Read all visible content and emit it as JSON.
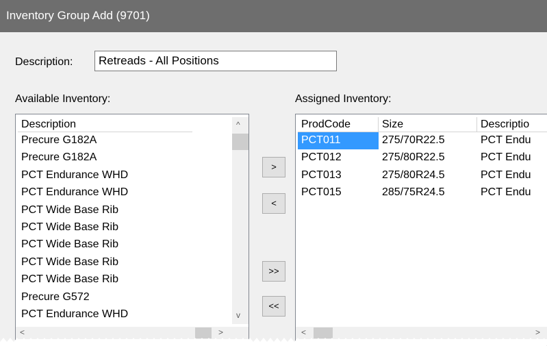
{
  "window": {
    "title": "Inventory Group Add (9701)"
  },
  "description": {
    "label": "Description:",
    "value": "Retreads - All Positions"
  },
  "available": {
    "label": "Available Inventory:",
    "header": "Description",
    "rows": [
      "Precure G182A",
      "Precure G182A",
      "PCT Endurance WHD",
      "PCT Endurance WHD",
      "PCT Wide Base Rib",
      "PCT Wide Base Rib",
      "PCT Wide Base Rib",
      "PCT Wide Base Rib",
      "PCT Wide Base Rib",
      "Precure G572",
      "PCT Endurance WHD"
    ]
  },
  "buttons": {
    "add": ">",
    "remove": "<",
    "add_all": ">>",
    "remove_all": "<<"
  },
  "assigned": {
    "label": "Assigned Inventory:",
    "headers": [
      "ProdCode",
      "Size",
      "Descriptio"
    ],
    "rows": [
      {
        "code": "PCT011",
        "size": "275/70R22.5",
        "desc": "PCT Endu"
      },
      {
        "code": "PCT012",
        "size": "275/80R22.5",
        "desc": "PCT Endu"
      },
      {
        "code": "PCT013",
        "size": "275/80R24.5",
        "desc": "PCT Endu"
      },
      {
        "code": "PCT015",
        "size": "285/75R24.5",
        "desc": "PCT Endu"
      }
    ]
  },
  "icons": {
    "scroll_up": "^",
    "scroll_down": "v",
    "scroll_left": "<",
    "scroll_right": ">"
  },
  "colors": {
    "titlebar": "#6e6e6e",
    "selection": "#3399ff"
  }
}
